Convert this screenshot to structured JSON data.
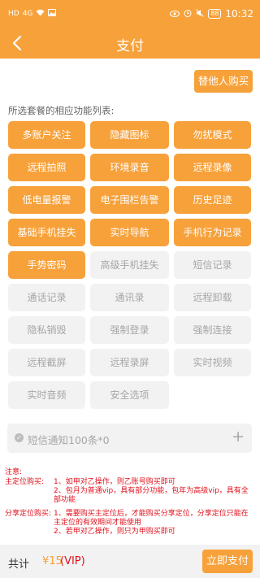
{
  "statusbar": {
    "left_icons": [
      "HD",
      "4G",
      "wifi-icon",
      "image-icon"
    ],
    "right_icons": [
      "eye-icon",
      "alarm-icon",
      "mute-icon"
    ],
    "battery": "88",
    "time": "10:32"
  },
  "nav": {
    "back_icon": "chevron-left-icon",
    "title": "支付"
  },
  "buy_for_other": "替他人购买",
  "feature_caption": "所选套餐的相应功能列表:",
  "features": [
    {
      "label": "多账户关注",
      "enabled": true
    },
    {
      "label": "隐藏图标",
      "enabled": true
    },
    {
      "label": "勿扰模式",
      "enabled": true
    },
    {
      "label": "远程拍照",
      "enabled": true
    },
    {
      "label": "环境录音",
      "enabled": true
    },
    {
      "label": "远程录像",
      "enabled": true
    },
    {
      "label": "低电量报警",
      "enabled": true
    },
    {
      "label": "电子围栏告警",
      "enabled": true
    },
    {
      "label": "历史足迹",
      "enabled": true
    },
    {
      "label": "基础手机挂失",
      "enabled": true
    },
    {
      "label": "实时导航",
      "enabled": true
    },
    {
      "label": "手机行为记录",
      "enabled": true
    },
    {
      "label": "手势密码",
      "enabled": true
    },
    {
      "label": "高级手机挂失",
      "enabled": false
    },
    {
      "label": "短信记录",
      "enabled": false
    },
    {
      "label": "通话记录",
      "enabled": false
    },
    {
      "label": "通讯录",
      "enabled": false
    },
    {
      "label": "远程卸载",
      "enabled": false
    },
    {
      "label": "隐私销毁",
      "enabled": false
    },
    {
      "label": "强制登录",
      "enabled": false
    },
    {
      "label": "强制连接",
      "enabled": false
    },
    {
      "label": "远程截屏",
      "enabled": false
    },
    {
      "label": "远程录屏",
      "enabled": false
    },
    {
      "label": "实时视频",
      "enabled": false
    },
    {
      "label": "实时音频",
      "enabled": false
    },
    {
      "label": "安全选项",
      "enabled": false
    }
  ],
  "sms_addon": {
    "label": "短信通知100条*0",
    "plus": "+"
  },
  "notes": {
    "title": "注意:",
    "main_label": "主定位购买:",
    "main_lines": [
      "1、如甲对乙操作，则乙账号购买即可",
      "2、包月为普通vip，具有部分功能，包年为高级vip，具有全部功能"
    ],
    "share_label": "分享定位购买:",
    "share_lines": [
      "1、需要购买主定位后，才能购买分享定位，分享定位只能在主定位的有效期间才能使用",
      "2、若甲对乙操作，则只为甲购买即可"
    ]
  },
  "bottom": {
    "total_label": "共计",
    "price": "¥15",
    "vip": "(VIP)",
    "pay_button": "立即支付"
  },
  "colors": {
    "accent": "#f7a13a",
    "warning": "#e0101c",
    "disabled_bg": "#f2f2f2"
  }
}
